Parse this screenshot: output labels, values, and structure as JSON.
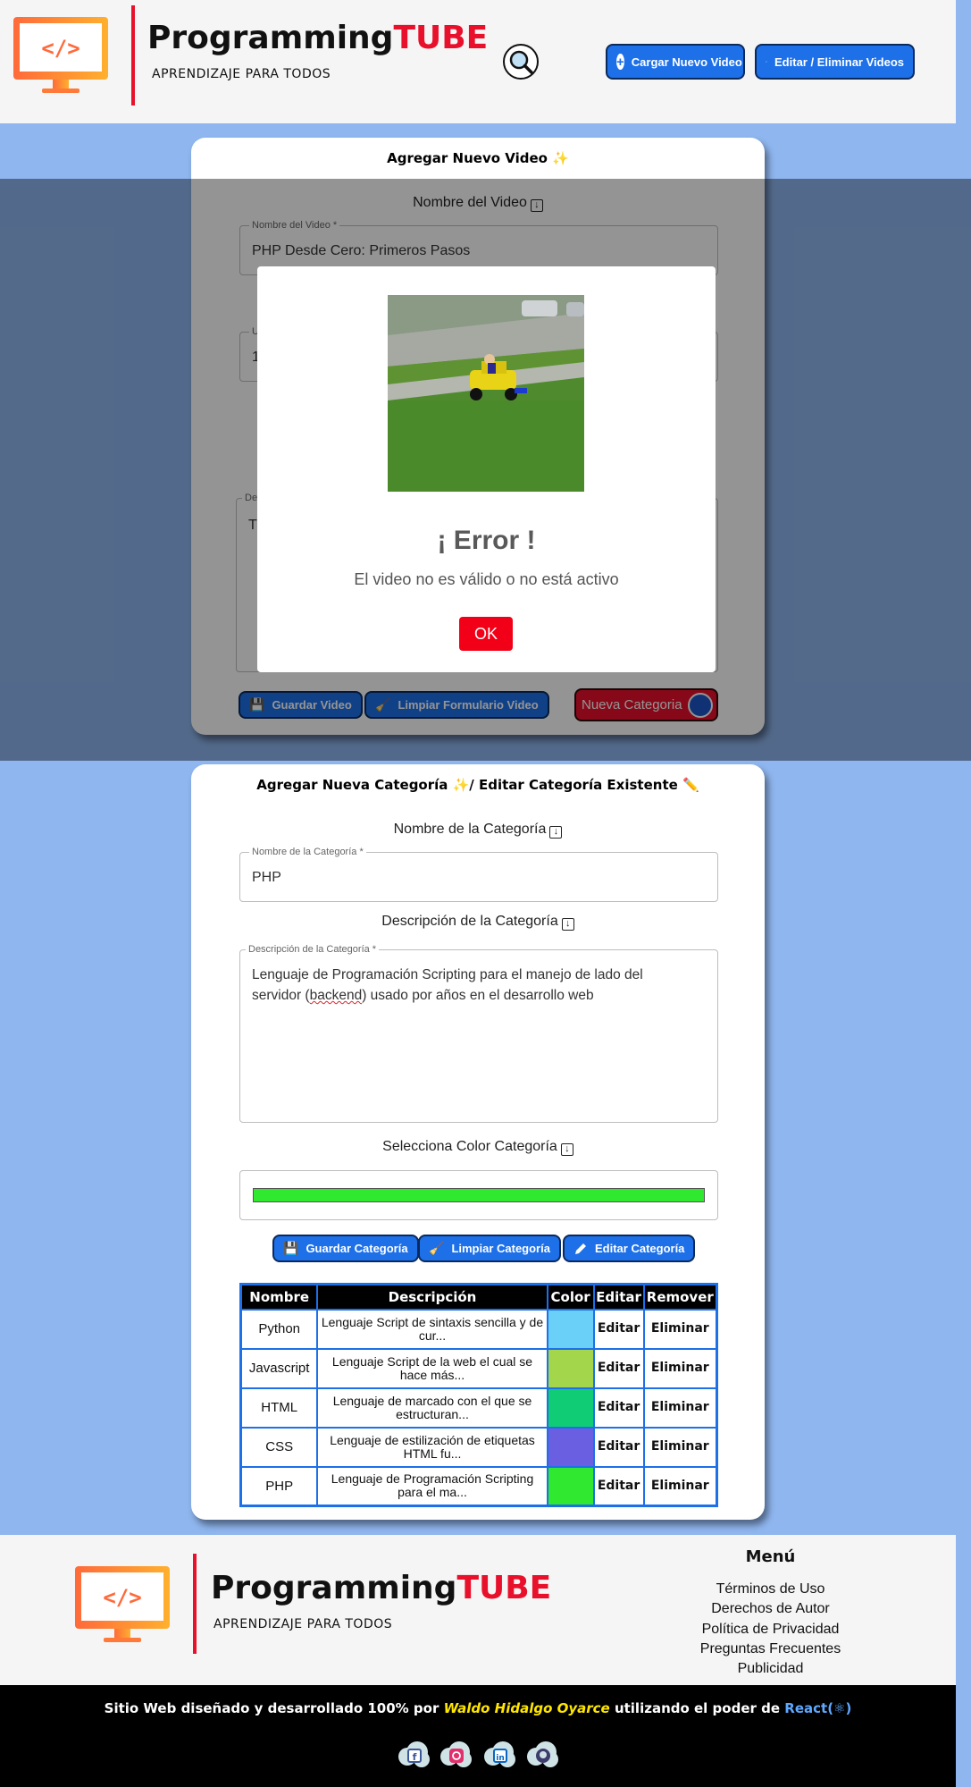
{
  "header": {
    "brand_main": "Programming",
    "brand_accent": "TUBE",
    "tagline": "APRENDIZAJE PARA TODOS",
    "upload_button": "Cargar Nuevo Video",
    "edit_button": "Editar / Eliminar Videos"
  },
  "video_card": {
    "title": "Agregar Nuevo Video ✨",
    "name_label": "Nombre del Video",
    "name_legend": "Nombre del Video *",
    "name_value": "PHP Desde Cero: Primeros Pasos",
    "url_legend_partial": "U",
    "url_value_partial": "1",
    "desc_legend_partial": "De",
    "desc_value_partial": "T",
    "save_button": "Guardar Video",
    "clear_button": "Limpiar Formulario Video",
    "new_category_button": "Nueva Categoria"
  },
  "modal": {
    "title": "¡ Error !",
    "message": "El video no es válido o no está activo",
    "ok_button": "OK"
  },
  "category_card": {
    "title": "Agregar Nueva Categoría ✨/ Editar Categoría Existente ✏️",
    "name_label": "Nombre de la Categoría",
    "name_legend": "Nombre de la Categoría *",
    "name_value": "PHP",
    "desc_label": "Descripción de la Categoría",
    "desc_legend": "Descripción de la Categoría *",
    "desc_line1": "Lenguaje de Programación Scripting para el manejo de lado del",
    "desc_line2_pre": "servidor (",
    "desc_line2_spell": "backend",
    "desc_line2_post": ") usado por años en el desarrollo web",
    "color_label": "Selecciona Color Categoría",
    "selected_color": "#2fe82f",
    "save_button": "Guardar Categoría",
    "clear_button": "Limpiar Categoría",
    "edit_button": "Editar Categoría"
  },
  "table": {
    "headers": [
      "Nombre",
      "Descripción",
      "Color",
      "Editar",
      "Remover"
    ],
    "rows": [
      {
        "name": "Python",
        "desc": "Lenguaje Script de sintaxis sencilla y de cur...",
        "color": "#6ad0f8",
        "edit": "Editar",
        "remove": "Eliminar"
      },
      {
        "name": "Javascript",
        "desc": "Lenguaje Script de la web el cual se hace más...",
        "color": "#a3d64a",
        "edit": "Editar",
        "remove": "Eliminar"
      },
      {
        "name": "HTML",
        "desc": "Lenguaje de marcado con el que se estructuran...",
        "color": "#10cc75",
        "edit": "Editar",
        "remove": "Eliminar"
      },
      {
        "name": "CSS",
        "desc": "Lenguaje de estilización de etiquetas HTML fu...",
        "color": "#6a5fe0",
        "edit": "Editar",
        "remove": "Eliminar"
      },
      {
        "name": "PHP",
        "desc": "Lenguaje de Programación Scripting para el ma...",
        "color": "#2fe82f",
        "edit": "Editar",
        "remove": "Eliminar"
      }
    ]
  },
  "footer": {
    "brand_main": "Programming",
    "brand_accent": "TUBE",
    "tagline": "APRENDIZAJE PARA TODOS",
    "menu_title": "Menú",
    "menu_links": [
      "Términos de Uso",
      "Derechos de Autor",
      "Política de Privacidad",
      "Preguntas Frecuentes",
      "Publicidad"
    ],
    "credit_pre": "Sitio Web diseñado y desarrollado 100% por ",
    "credit_author": "Waldo Hidalgo Oyarce",
    "credit_mid": " utilizando el poder de ",
    "credit_react": "React",
    "credit_react_icon": "(⚛)",
    "social_icons": [
      "facebook-icon",
      "instagram-icon",
      "linkedin-icon",
      "github-icon"
    ]
  },
  "colors": {
    "accent_red": "#e8102b",
    "primary_blue": "#1d70e8",
    "page_bg": "#8fb6ef"
  }
}
